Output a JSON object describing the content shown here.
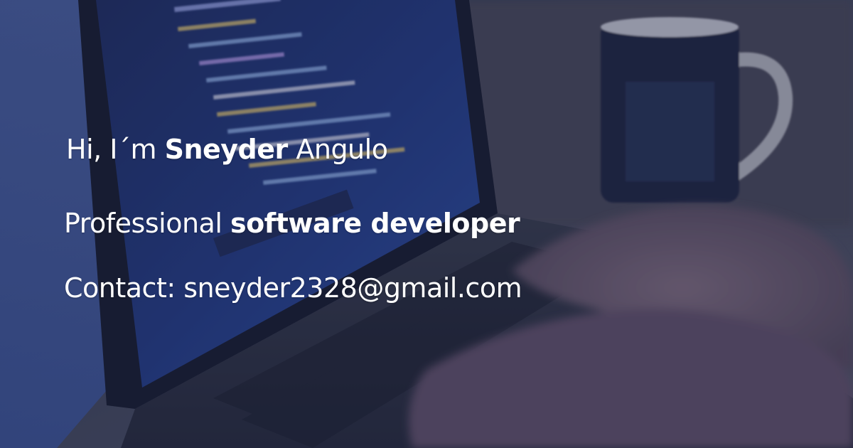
{
  "greeting": {
    "prefix": "Hi, I´m ",
    "first_name": "Sneyder",
    "last_name": " Angulo"
  },
  "tagline": {
    "prefix": "Professional ",
    "role": "software developer"
  },
  "contact": {
    "label": "Contact: ",
    "email": "sneyder2328@gmail.com"
  },
  "colors": {
    "overlay": "#1e263e",
    "text": "#ffffff",
    "screen_glow": "#3b5ec9",
    "mug": "#1b2340"
  }
}
